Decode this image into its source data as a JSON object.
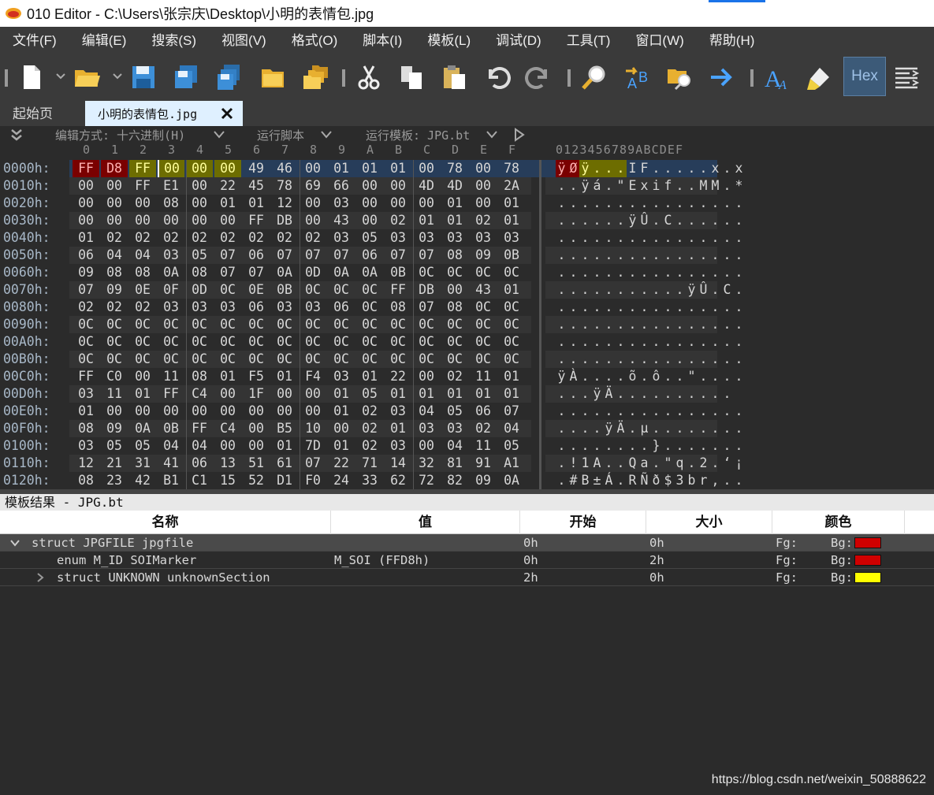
{
  "window": {
    "title": "010 Editor - C:\\Users\\张宗庆\\Desktop\\小明的表情包.jpg"
  },
  "menu": [
    "文件(F)",
    "编辑(E)",
    "搜索(S)",
    "视图(V)",
    "格式(O)",
    "脚本(I)",
    "模板(L)",
    "调试(D)",
    "工具(T)",
    "窗口(W)",
    "帮助(H)"
  ],
  "toolbar": {
    "hex_label": "Hex"
  },
  "tabs": {
    "start": "起始页",
    "active": "小明的表情包.jpg"
  },
  "options": {
    "edit_mode": "编辑方式: 十六进制(H)",
    "run_script": "运行脚本",
    "run_template": "运行模板: JPG.bt"
  },
  "hex": {
    "col_headers": [
      "0",
      "1",
      "2",
      "3",
      "4",
      "5",
      "6",
      "7",
      "8",
      "9",
      "A",
      "B",
      "C",
      "D",
      "E",
      "F"
    ],
    "ascii_header": "0123456789ABCDEF",
    "rows": [
      {
        "addr": "0000h:",
        "bytes": [
          "FF",
          "D8",
          "FF",
          "00",
          "00",
          "00",
          "49",
          "46",
          "00",
          "01",
          "01",
          "01",
          "00",
          "78",
          "00",
          "78"
        ],
        "ascii": "ÿØÿ...IF.....x.x"
      },
      {
        "addr": "0010h:",
        "bytes": [
          "00",
          "00",
          "FF",
          "E1",
          "00",
          "22",
          "45",
          "78",
          "69",
          "66",
          "00",
          "00",
          "4D",
          "4D",
          "00",
          "2A"
        ],
        "ascii": "..ÿá.\"Exif..MM.*"
      },
      {
        "addr": "0020h:",
        "bytes": [
          "00",
          "00",
          "00",
          "08",
          "00",
          "01",
          "01",
          "12",
          "00",
          "03",
          "00",
          "00",
          "00",
          "01",
          "00",
          "01"
        ],
        "ascii": "................"
      },
      {
        "addr": "0030h:",
        "bytes": [
          "00",
          "00",
          "00",
          "00",
          "00",
          "00",
          "FF",
          "DB",
          "00",
          "43",
          "00",
          "02",
          "01",
          "01",
          "02",
          "01"
        ],
        "ascii": "......ÿÛ.C......"
      },
      {
        "addr": "0040h:",
        "bytes": [
          "01",
          "02",
          "02",
          "02",
          "02",
          "02",
          "02",
          "02",
          "02",
          "03",
          "05",
          "03",
          "03",
          "03",
          "03",
          "03"
        ],
        "ascii": "................"
      },
      {
        "addr": "0050h:",
        "bytes": [
          "06",
          "04",
          "04",
          "03",
          "05",
          "07",
          "06",
          "07",
          "07",
          "07",
          "06",
          "07",
          "07",
          "08",
          "09",
          "0B"
        ],
        "ascii": "................"
      },
      {
        "addr": "0060h:",
        "bytes": [
          "09",
          "08",
          "08",
          "0A",
          "08",
          "07",
          "07",
          "0A",
          "0D",
          "0A",
          "0A",
          "0B",
          "0C",
          "0C",
          "0C",
          "0C"
        ],
        "ascii": "................"
      },
      {
        "addr": "0070h:",
        "bytes": [
          "07",
          "09",
          "0E",
          "0F",
          "0D",
          "0C",
          "0E",
          "0B",
          "0C",
          "0C",
          "0C",
          "FF",
          "DB",
          "00",
          "43",
          "01"
        ],
        "ascii": "...........ÿÛ.C."
      },
      {
        "addr": "0080h:",
        "bytes": [
          "02",
          "02",
          "02",
          "03",
          "03",
          "03",
          "06",
          "03",
          "03",
          "06",
          "0C",
          "08",
          "07",
          "08",
          "0C",
          "0C"
        ],
        "ascii": "................"
      },
      {
        "addr": "0090h:",
        "bytes": [
          "0C",
          "0C",
          "0C",
          "0C",
          "0C",
          "0C",
          "0C",
          "0C",
          "0C",
          "0C",
          "0C",
          "0C",
          "0C",
          "0C",
          "0C",
          "0C"
        ],
        "ascii": "................"
      },
      {
        "addr": "00A0h:",
        "bytes": [
          "0C",
          "0C",
          "0C",
          "0C",
          "0C",
          "0C",
          "0C",
          "0C",
          "0C",
          "0C",
          "0C",
          "0C",
          "0C",
          "0C",
          "0C",
          "0C"
        ],
        "ascii": "................"
      },
      {
        "addr": "00B0h:",
        "bytes": [
          "0C",
          "0C",
          "0C",
          "0C",
          "0C",
          "0C",
          "0C",
          "0C",
          "0C",
          "0C",
          "0C",
          "0C",
          "0C",
          "0C",
          "0C",
          "0C"
        ],
        "ascii": "................"
      },
      {
        "addr": "00C0h:",
        "bytes": [
          "FF",
          "C0",
          "00",
          "11",
          "08",
          "01",
          "F5",
          "01",
          "F4",
          "03",
          "01",
          "22",
          "00",
          "02",
          "11",
          "01"
        ],
        "ascii": "ÿÀ....õ.ô..\"...."
      },
      {
        "addr": "00D0h:",
        "bytes": [
          "03",
          "11",
          "01",
          "FF",
          "C4",
          "00",
          "1F",
          "00",
          "00",
          "01",
          "05",
          "01",
          "01",
          "01",
          "01",
          "01"
        ],
        "ascii": "...ÿÄ.........."
      },
      {
        "addr": "00E0h:",
        "bytes": [
          "01",
          "00",
          "00",
          "00",
          "00",
          "00",
          "00",
          "00",
          "00",
          "01",
          "02",
          "03",
          "04",
          "05",
          "06",
          "07"
        ],
        "ascii": "................"
      },
      {
        "addr": "00F0h:",
        "bytes": [
          "08",
          "09",
          "0A",
          "0B",
          "FF",
          "C4",
          "00",
          "B5",
          "10",
          "00",
          "02",
          "01",
          "03",
          "03",
          "02",
          "04"
        ],
        "ascii": "....ÿÄ.µ........"
      },
      {
        "addr": "0100h:",
        "bytes": [
          "03",
          "05",
          "05",
          "04",
          "04",
          "00",
          "00",
          "01",
          "7D",
          "01",
          "02",
          "03",
          "00",
          "04",
          "11",
          "05"
        ],
        "ascii": "........}......."
      },
      {
        "addr": "0110h:",
        "bytes": [
          "12",
          "21",
          "31",
          "41",
          "06",
          "13",
          "51",
          "61",
          "07",
          "22",
          "71",
          "14",
          "32",
          "81",
          "91",
          "A1"
        ],
        "ascii": ".!1A..Qa.\"q.2.‘¡"
      },
      {
        "addr": "0120h:",
        "bytes": [
          "08",
          "23",
          "42",
          "B1",
          "C1",
          "15",
          "52",
          "D1",
          "F0",
          "24",
          "33",
          "62",
          "72",
          "82",
          "09",
          "0A"
        ],
        "ascii": ".#B±Á.RÑð$3br,.."
      }
    ]
  },
  "template_panel": {
    "title": "模板结果 - JPG.bt",
    "headers": [
      "名称",
      "值",
      "开始",
      "大小",
      "颜色"
    ],
    "rows": [
      {
        "name": "struct JPGFILE jpgfile",
        "value": "",
        "start": "0h",
        "size": "0h",
        "fg": "Fg:",
        "bg": "Bg:",
        "bgcolor": "#d00000"
      },
      {
        "name": "enum M_ID SOIMarker",
        "value": "M_SOI (FFD8h)",
        "start": "0h",
        "size": "2h",
        "fg": "Fg:",
        "bg": "Bg:",
        "bgcolor": "#d00000"
      },
      {
        "name": "struct UNKNOWN unknownSection",
        "value": "",
        "start": "2h",
        "size": "0h",
        "fg": "Fg:",
        "bg": "Bg:",
        "bgcolor": "#ffff00"
      }
    ]
  },
  "watermark": "https://blog.csdn.net/weixin_50888622"
}
